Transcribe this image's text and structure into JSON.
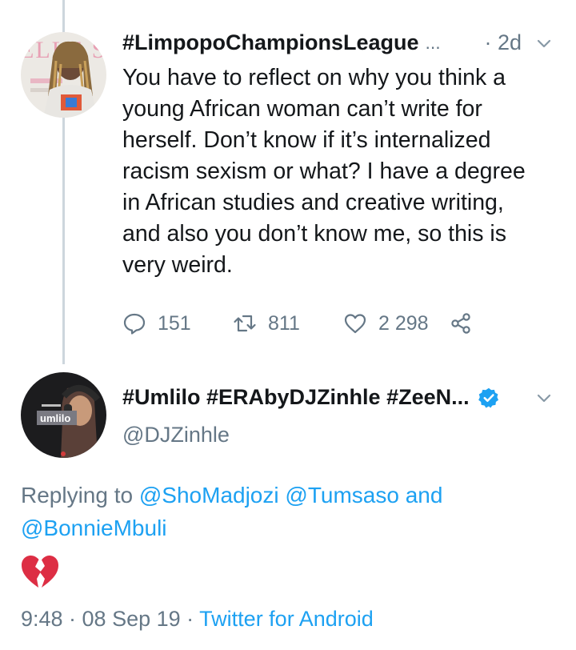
{
  "tweet1": {
    "display_name": "#LimpopoChampionsLeague",
    "ellipsis": "...",
    "time": "· 2d",
    "text": "You have to reflect on why you think a young African woman can’t write for herself. Don’t know if it’s internalized racism sexism or what? I have a degree in African studies and creative writing, and also you don’t know me, so this is very weird.",
    "replies": "151",
    "retweets": "811",
    "likes": "2 298",
    "avatar_text": "ELLE SHO"
  },
  "tweet2": {
    "display_name": "#Umlilo #ERAbyDJZinhle #ZeeN...",
    "handle": "@DJZinhle",
    "verified": true,
    "avatar_text": "umlilo",
    "reply_prefix": "Replying to",
    "mention1": "@ShoMadjozi",
    "mention2": "@Tumsaso",
    "reply_and": "and",
    "mention3": "@BonnieMbuli",
    "emoji": "broken-heart-icon",
    "timestamp": "9:48 · 08 Sep 19 ·",
    "source": "Twitter for Android"
  },
  "colors": {
    "accent": "#1da1f2",
    "muted": "#657786",
    "text": "#14171a",
    "heart_red": "#dd2e44"
  }
}
